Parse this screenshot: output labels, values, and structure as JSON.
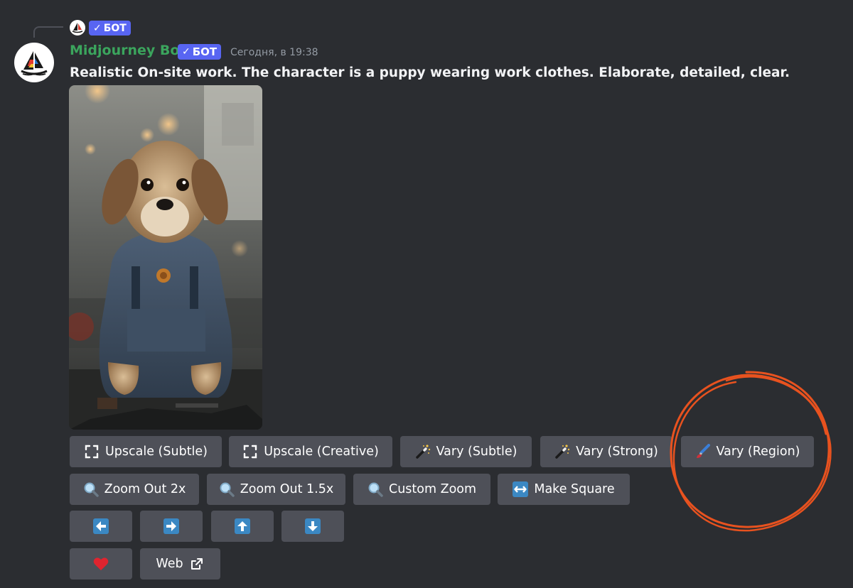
{
  "message": {
    "reply_tag": "БОТ",
    "username": "Midjourney Bot",
    "bot_tag": "БОТ",
    "timestamp": "Сегодня, в 19:38",
    "prompt": "Realistic On-site work. The character is a puppy wearing work clothes. Elaborate, detailed, clear."
  },
  "buttons": {
    "row1": [
      {
        "label": "Upscale (Subtle)",
        "icon": "expand-icon"
      },
      {
        "label": "Upscale (Creative)",
        "icon": "expand-icon"
      },
      {
        "label": "Vary (Subtle)",
        "icon": "magic-wand-icon"
      },
      {
        "label": "Vary (Strong)",
        "icon": "magic-wand-icon"
      },
      {
        "label": "Vary (Region)",
        "icon": "paintbrush-icon"
      }
    ],
    "row2": [
      {
        "label": "Zoom Out 2x",
        "icon": "magnifier-icon"
      },
      {
        "label": "Zoom Out 1.5x",
        "icon": "magnifier-icon"
      },
      {
        "label": "Custom Zoom",
        "icon": "magnifier-icon"
      },
      {
        "label": "Make Square",
        "icon": "left-right-arrow-icon"
      }
    ],
    "row3": [
      {
        "icon": "arrow-left-icon"
      },
      {
        "icon": "arrow-right-icon"
      },
      {
        "icon": "arrow-up-icon"
      },
      {
        "icon": "arrow-down-icon"
      }
    ],
    "row4": [
      {
        "icon": "heart-icon"
      },
      {
        "label": "Web",
        "icon": "external-link-icon"
      }
    ]
  },
  "colors": {
    "background": "#2b2d31",
    "button": "#4e5058",
    "bot_tag": "#5865f2",
    "username": "#3ba55d",
    "annotation": "#e8521f"
  }
}
